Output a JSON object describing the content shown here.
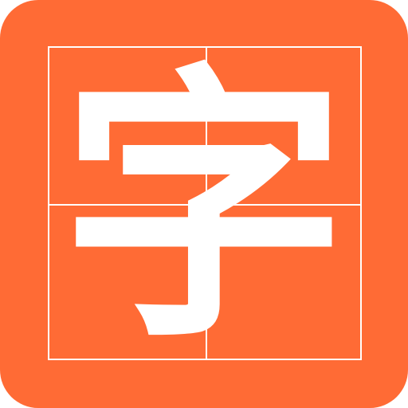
{
  "icon": {
    "glyph": "字",
    "colors": {
      "tile": "#FF6B35",
      "grid": "#FFFFFF",
      "glyph": "#FFFFFF"
    }
  }
}
